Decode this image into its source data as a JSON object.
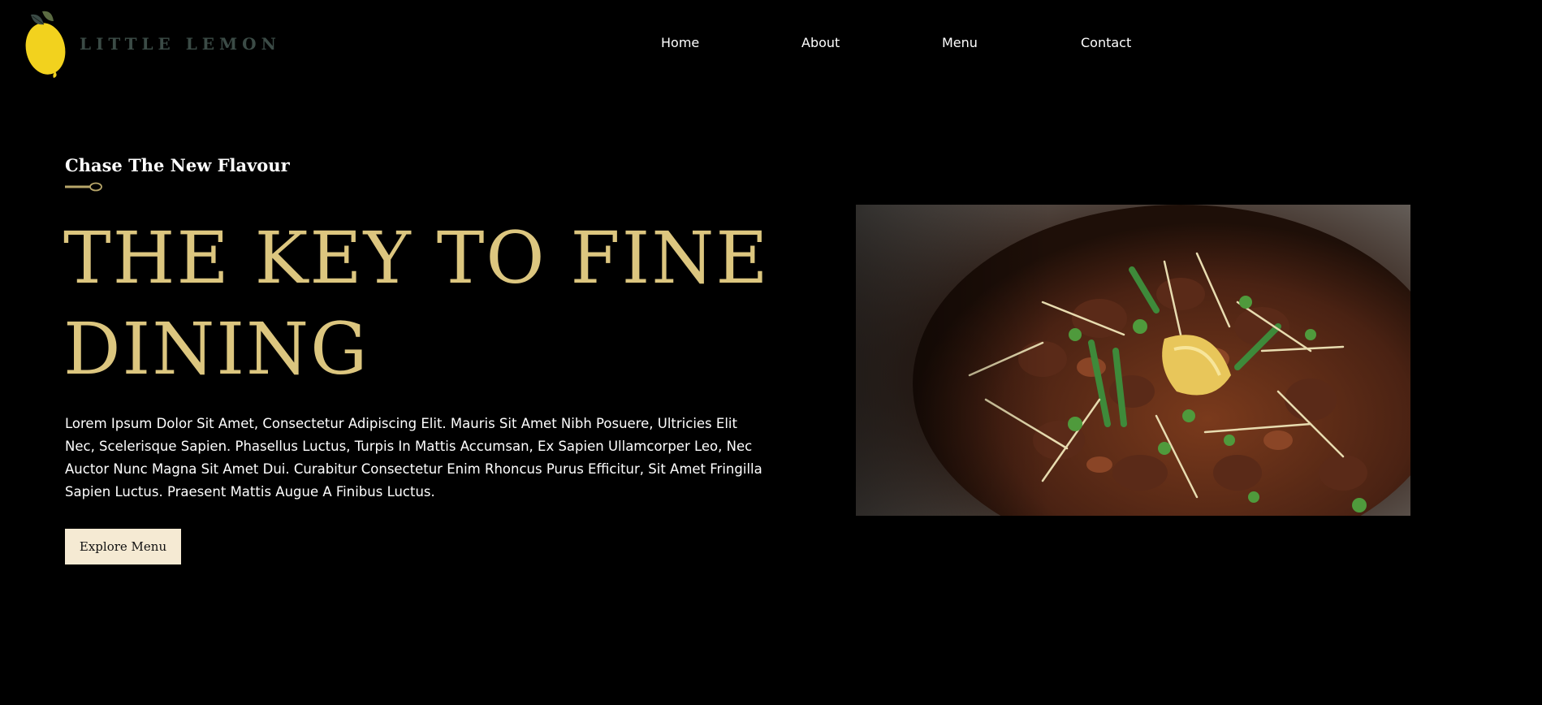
{
  "brand": {
    "name": "LITTLE LEMON",
    "logo_icon": "lemon-icon",
    "logo_color": "#3b4b46",
    "lemon_color": "#f2d21e"
  },
  "nav": {
    "items": [
      {
        "label": "Home"
      },
      {
        "label": "About"
      },
      {
        "label": "Menu"
      },
      {
        "label": "Contact"
      }
    ]
  },
  "hero": {
    "tagline": "Chase The New Flavour",
    "divider_icon": "spoon-icon",
    "title_line1": "THE KEY TO FINE",
    "title_line2": "DINING",
    "description": "Lorem Ipsum Dolor Sit Amet, Consectetur Adipiscing Elit. Mauris Sit Amet Nibh Posuere, Ultricies Elit Nec, Scelerisque Sapien. Phasellus Luctus, Turpis In Mattis Accumsan, Ex Sapien Ullamcorper Leo, Nec Auctor Nunc Magna Sit Amet Dui. Curabitur Consectetur Enim Rhoncus Purus Efficitur, Sit Amet Fringilla Sapien Luctus. Praesent Mattis Augue A Finibus Luctus.",
    "cta_label": "Explore Menu",
    "image_icon": "dish-photo",
    "title_color": "#dcc67f",
    "cta_background": "#f5ead3"
  }
}
